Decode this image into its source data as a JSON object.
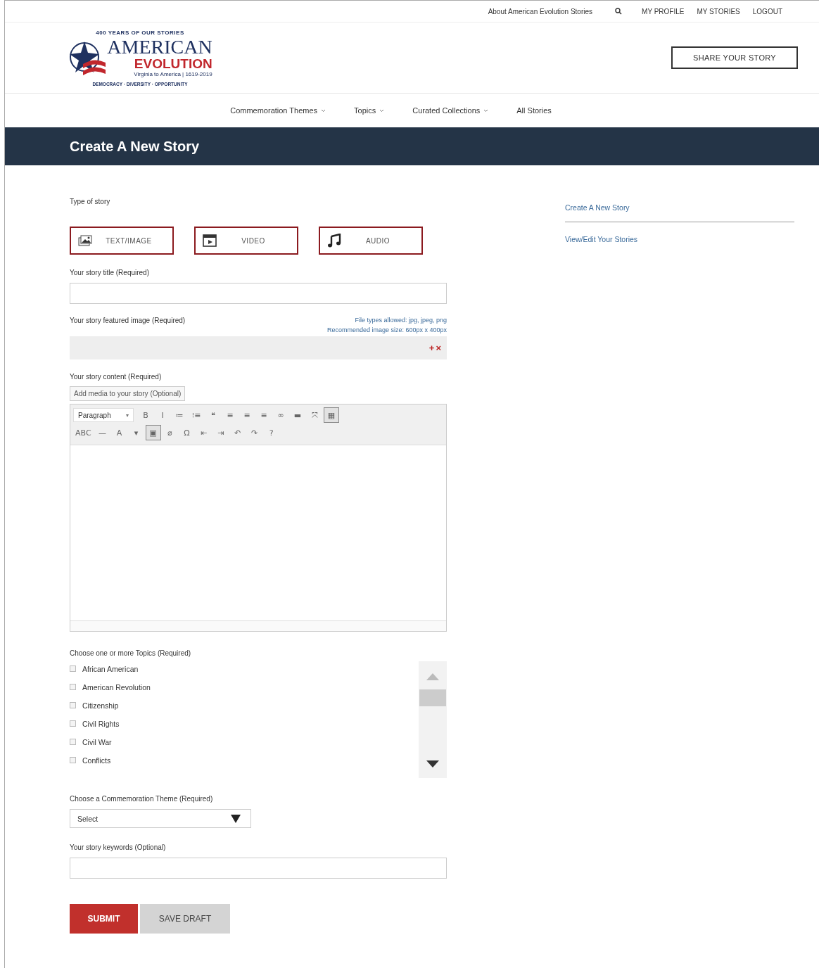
{
  "top_bar": {
    "about_link": "About American Evolution Stories",
    "links": [
      "MY PROFILE",
      "MY STORIES",
      "LOGOUT"
    ]
  },
  "logo": {
    "tagline_top": "400 YEARS OF OUR STORIES",
    "line1": "AMERICAN",
    "line2": "EVOLUTION",
    "subline": "Virginia to America | 1619-2019",
    "tagline_bottom": "DEMOCRACY · DIVERSITY · OPPORTUNITY"
  },
  "share_button": "SHARE YOUR STORY",
  "nav": [
    {
      "label": "Commemoration Themes",
      "dropdown": true
    },
    {
      "label": "Topics",
      "dropdown": true
    },
    {
      "label": "Curated Collections",
      "dropdown": true
    },
    {
      "label": "All Stories",
      "dropdown": false
    }
  ],
  "page_title": "Create A New Story",
  "sidebar": {
    "items": [
      {
        "label": "Create A New Story",
        "selected": true
      },
      {
        "label": "View/Edit Your Stories",
        "selected": false
      }
    ]
  },
  "form": {
    "type_label": "Type of story",
    "story_types": [
      {
        "kind": "image",
        "label": "TEXT/IMAGE"
      },
      {
        "kind": "video",
        "label": "VIDEO"
      },
      {
        "kind": "audio",
        "label": "AUDIO"
      }
    ],
    "title_label": "Your story title (Required)",
    "image_label": "Your story featured image (Required)",
    "image_hints": [
      "File types allowed: jpg, jpeg, png",
      "Recommended image size: 600px x 400px"
    ],
    "upload_controls": [
      "+",
      "×"
    ],
    "content_label": "Your story content (Required)",
    "add_media": "Add media to your story (Optional)",
    "editor": {
      "format": "Paragraph",
      "format_caret": "▾",
      "toolbar_rows": [
        [
          {
            "glyph": "B",
            "selected": false
          },
          {
            "glyph": "I",
            "selected": false
          },
          {
            "glyph": "≔",
            "selected": false
          },
          {
            "glyph": "⁝≡",
            "selected": false
          },
          {
            "glyph": "❝",
            "selected": false
          },
          {
            "glyph": "≡",
            "selected": false
          },
          {
            "glyph": "≡",
            "selected": false
          },
          {
            "glyph": "≡",
            "selected": false
          },
          {
            "glyph": "∞",
            "selected": false
          },
          {
            "glyph": "▬",
            "selected": false
          },
          {
            "glyph": "⤧",
            "selected": false
          },
          {
            "glyph": "▦",
            "selected": true
          }
        ],
        [
          {
            "glyph": "ABC",
            "selected": false
          },
          {
            "glyph": "—",
            "selected": false
          },
          {
            "glyph": "A",
            "selected": false
          },
          {
            "glyph": "▾",
            "selected": false
          },
          {
            "glyph": "▣",
            "selected": true
          },
          {
            "glyph": "⌀",
            "selected": false
          },
          {
            "glyph": "Ω",
            "selected": false
          },
          {
            "glyph": "⇤",
            "selected": false
          },
          {
            "glyph": "⇥",
            "selected": false
          },
          {
            "glyph": "↶",
            "selected": false
          },
          {
            "glyph": "↷",
            "selected": false
          },
          {
            "glyph": "?",
            "selected": false
          }
        ]
      ]
    },
    "topics_label": "Choose one or more Topics (Required)",
    "topics": [
      {
        "label": "African American",
        "checked": false
      },
      {
        "label": "American Revolution",
        "checked": false
      },
      {
        "label": "Citizenship",
        "checked": false
      },
      {
        "label": "Civil Rights",
        "checked": false
      },
      {
        "label": "Civil War",
        "checked": false
      },
      {
        "label": "Conflicts",
        "checked": false
      }
    ],
    "theme_label": "Choose a Commemoration Theme (Required)",
    "theme_select": {
      "value": "Select"
    },
    "keywords_label": "Your story keywords (Optional)",
    "buttons": [
      {
        "kind": "primary",
        "label": "SUBMIT"
      },
      {
        "kind": "secondary",
        "label": "SAVE DRAFT"
      }
    ]
  }
}
